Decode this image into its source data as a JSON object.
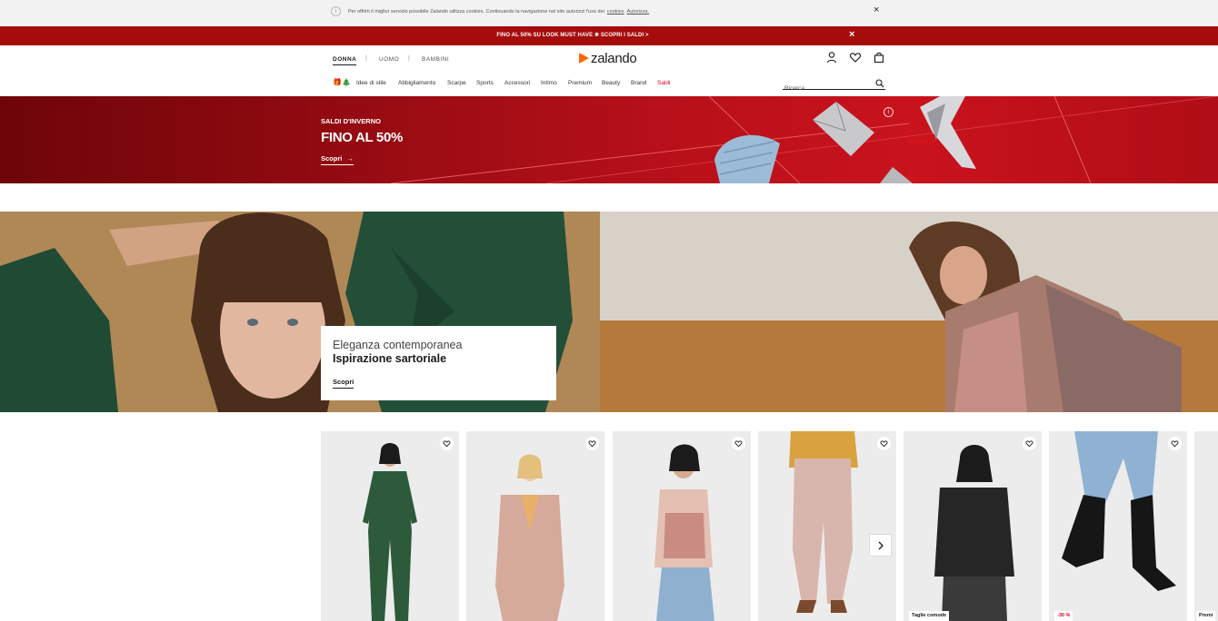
{
  "cookie_bar": {
    "info_glyph": "i",
    "text": "Per offrirti il miglior servizio possibile Zalando utilizza cookies. Continuando la navigazione nel sito autorizzi l'uso dei",
    "link_cookies": "cookies",
    "link_authorize": "Autorizza.",
    "close": "×"
  },
  "promo_bar": {
    "text": "FINO AL 50% SU LOOK MUST HAVE ❄ SCOPRI I SALDI >",
    "close": "×"
  },
  "header": {
    "genders": [
      {
        "label": "DONNA",
        "active": true
      },
      {
        "label": "UOMO",
        "active": false
      },
      {
        "label": "BAMBINI",
        "active": false
      }
    ],
    "separators": [
      "|",
      "|"
    ],
    "logo": "zalando",
    "icons": [
      "user-icon",
      "heart-icon",
      "bag-icon"
    ],
    "gift_glyph": "🎁🎄",
    "nav": [
      "Idee di stile",
      "Abbigliamento",
      "Scarpe",
      "Sports",
      "Accessori",
      "Intimo",
      "Premium",
      "Beauty",
      "Brand",
      "Saldi"
    ],
    "search": {
      "placeholder": "Ricerca",
      "icon": "search-icon"
    }
  },
  "winter_banner": {
    "eyebrow": "SALDI D'INVERNO",
    "headline": "FINO AL 50%",
    "cta": "Scopri",
    "cta_arrow": "→",
    "info_glyph": "i"
  },
  "editorial": {
    "line1": "Eleganza contemporanea",
    "line2": "Ispirazione sartoriale",
    "cta": "Scopri"
  },
  "products": [
    {
      "id": "green-jumpsuit",
      "tag": ""
    },
    {
      "id": "check-blazer",
      "tag": ""
    },
    {
      "id": "pink-cami",
      "tag": ""
    },
    {
      "id": "check-trousers",
      "tag": ""
    },
    {
      "id": "black-blouse",
      "tag": "Taglie comode"
    },
    {
      "id": "black-boots",
      "tag": "-30 %"
    },
    {
      "id": "partial-card",
      "tag": "Premi"
    }
  ],
  "colors": {
    "promo_red": "#a50c0c",
    "banner_red": "#c9131d",
    "sale_text": "#d0021b",
    "logo_orange": "#ff6900"
  }
}
